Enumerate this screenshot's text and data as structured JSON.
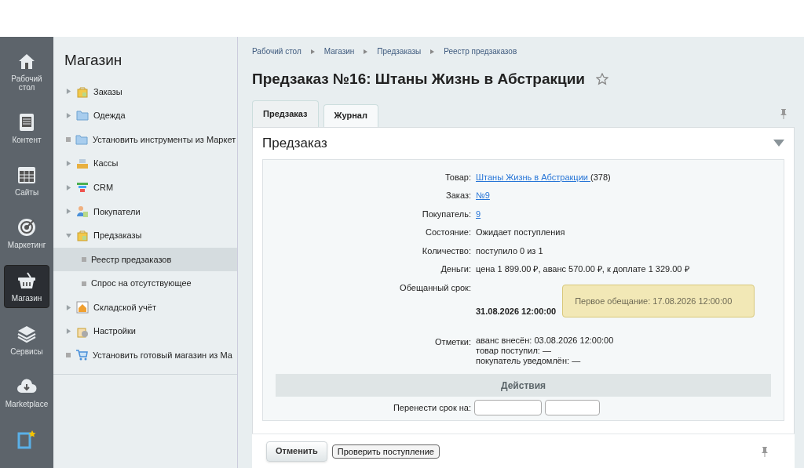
{
  "nav": [
    {
      "label": "Рабочий стол",
      "selected": false
    },
    {
      "label": "Контент",
      "selected": false
    },
    {
      "label": "Сайты",
      "selected": false
    },
    {
      "label": "Маркетинг",
      "selected": false
    },
    {
      "label": "Магазин",
      "selected": true
    },
    {
      "label": "Сервисы",
      "selected": false
    },
    {
      "label": "Marketplace",
      "selected": false
    },
    {
      "selected": false
    }
  ],
  "menu": {
    "title": "Магазин",
    "items": [
      {
        "label": "Заказы",
        "expanded": false,
        "selected": false
      },
      {
        "label": "Одежда",
        "expanded": false,
        "selected": false
      },
      {
        "label": "Установить инструменты из Маркет",
        "selected": false
      },
      {
        "label": "Кассы",
        "expanded": false,
        "selected": false
      },
      {
        "label": "CRM",
        "expanded": false,
        "selected": false
      },
      {
        "label": "Покупатели",
        "expanded": false,
        "selected": false
      },
      {
        "label": "Предзаказы",
        "expanded": true,
        "selected": false,
        "children": [
          {
            "label": "Реестр предзаказов",
            "selected": true
          },
          {
            "label": "Спрос на отсутствующее",
            "selected": false
          }
        ]
      },
      {
        "label": "Складской учёт",
        "expanded": false,
        "selected": false
      },
      {
        "label": "Настройки",
        "expanded": false,
        "selected": false
      },
      {
        "label": "Установить готовый магазин из Ма",
        "selected": false
      }
    ]
  },
  "breadcrumbs": [
    "Рабочий стол",
    "Магазин",
    "Предзаказы",
    "Реестр предзаказов"
  ],
  "title": "Предзаказ №16: Штаны Жизнь в Абстракции",
  "favorite": false,
  "tabs": [
    {
      "label": "Предзаказ",
      "selected": true
    },
    {
      "label": "Журнал",
      "selected": false
    }
  ],
  "section": {
    "title": "Предзаказ",
    "expanded": true
  },
  "fields": [
    {
      "label": "Товар:",
      "kind": "link",
      "link": "Штаны Жизнь в Абстракции ",
      "suffix": "(378)"
    },
    {
      "label": "Заказ:",
      "kind": "link",
      "link": "№9"
    },
    {
      "label": "Покупатель:",
      "kind": "link",
      "link": "9"
    },
    {
      "label": "Состояние:",
      "kind": "text",
      "value": "Ожидает поступления"
    },
    {
      "label": "Количество:",
      "kind": "text",
      "value": "поступило 0 из 1"
    },
    {
      "label": "Деньги:",
      "kind": "text",
      "value": "цена 1 899.00 ₽, аванс 570.00 ₽, к доплате 1 329.00 ₽"
    },
    {
      "label": "Обещанный срок:",
      "kind": "deadline",
      "value": "31.08.2026 12:00:00",
      "note": "Первое обещание: 17.08.2026 12:00:00"
    },
    {
      "label": "Отметки:",
      "kind": "lines",
      "lines": [
        "аванс внесён: 03.08.2026 12:00:00",
        "товар поступил: —",
        "покупатель уведомлён: —"
      ]
    }
  ],
  "actions_header": "Действия",
  "reschedule_label": "Перенести срок на:",
  "buttons": [
    {
      "label": "Отменить",
      "kind": "primary"
    },
    {
      "label": "Проверить поступление",
      "kind": "plain"
    }
  ]
}
